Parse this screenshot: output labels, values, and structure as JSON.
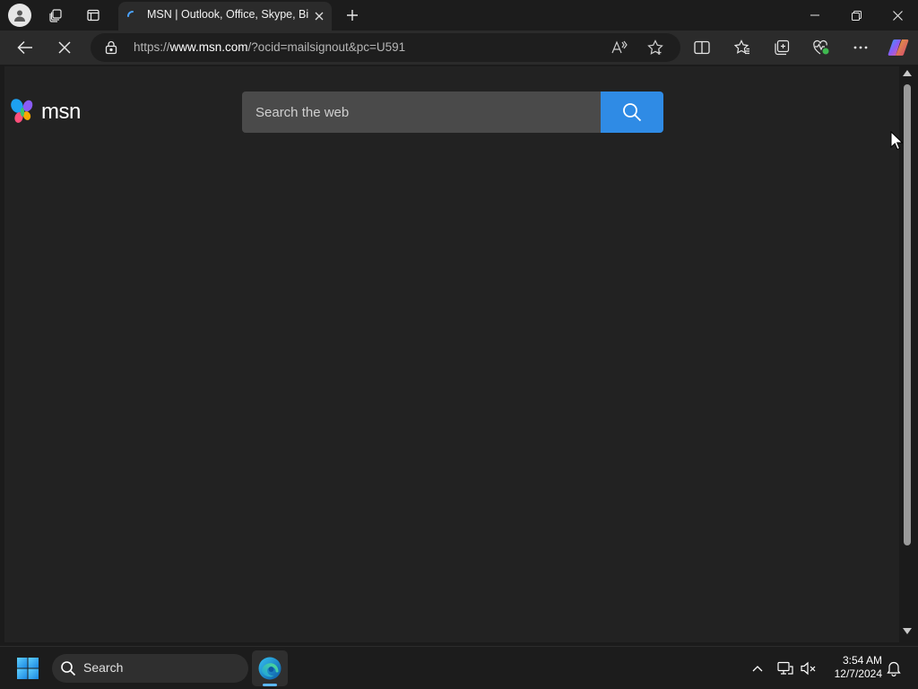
{
  "browser": {
    "tab": {
      "title": "MSN | Outlook, Office, Skype, Bing, Breaking News, and Latest Videos"
    },
    "address": {
      "scheme": "https://",
      "host": "www.msn.com",
      "path": "/?ocid=mailsignout&pc=U591"
    }
  },
  "page": {
    "logo": "msn",
    "search": {
      "placeholder": "Search the web"
    }
  },
  "taskbar": {
    "search_label": "Search",
    "time": "3:54 AM",
    "date": "12/7/2024"
  },
  "colors": {
    "accent": "#2f8be5",
    "page_bg": "#222222",
    "chrome_bg": "#2b2b2b"
  },
  "icons": {
    "profile": "profile-avatar-icon",
    "workspaces": "workspaces-icon",
    "tab_actions": "tab-actions-icon",
    "reload": "stop-loading-icon",
    "read_aloud": "read-aloud-icon",
    "favorite": "star-icon",
    "split": "split-screen-icon",
    "favorites": "favorites-icon",
    "collections": "collections-icon",
    "performance": "browser-essentials-icon",
    "more": "more-icon",
    "copilot": "copilot-icon"
  }
}
